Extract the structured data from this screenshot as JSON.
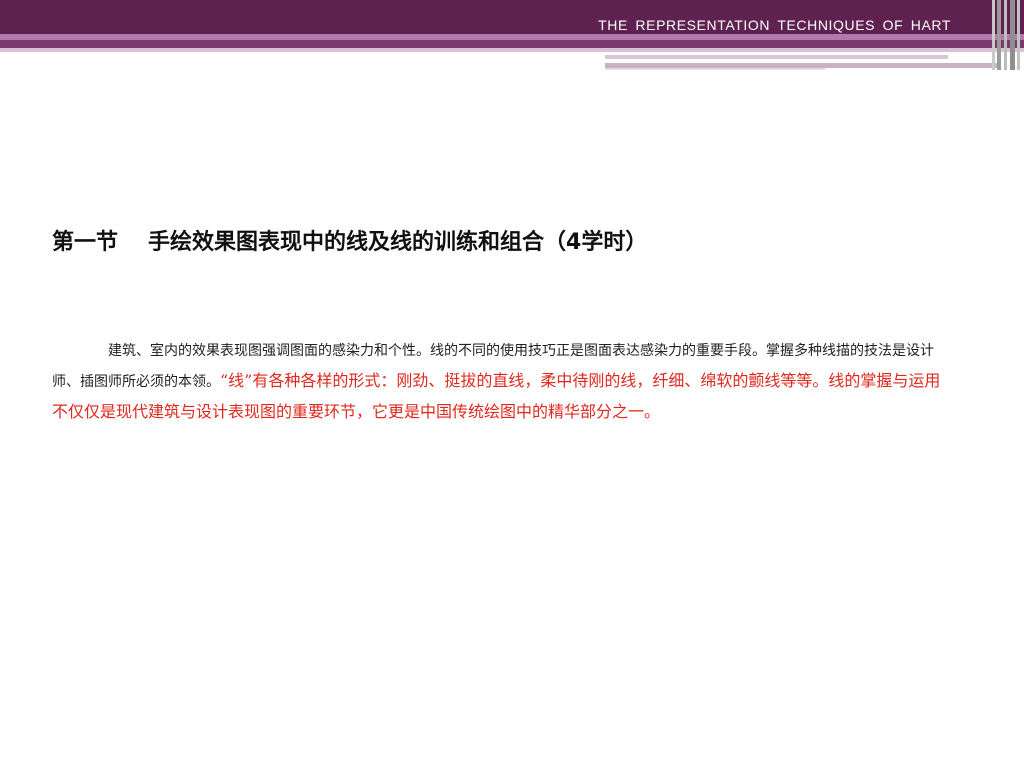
{
  "header": {
    "title": "THE  REPRESENTATION  TECHNIQUES  OF  HART"
  },
  "heading": {
    "section_no": "第一节",
    "title": "手绘效果图表现中的线及线的训练和组合（4学时）"
  },
  "body": {
    "normal_text": "建筑、室内的效果表现图强调图面的感染力和个性。线的不同的使用技巧正是图面表达感染力的重要手段。掌握多种线描的技法是设计师、插图师所必须的本领。",
    "highlight_text": "“线”有各种各样的形式：刚劲、挺拔的直线，柔中待刚的线，纤细、绵软的颤线等等。线的掌握与运用不仅仅是现代建筑与设计表现图的重要环节，它更是中国传统绘图中的精华部分之一。"
  },
  "colors": {
    "header_band": "#5e2150",
    "highlight_text": "#e0281e"
  }
}
